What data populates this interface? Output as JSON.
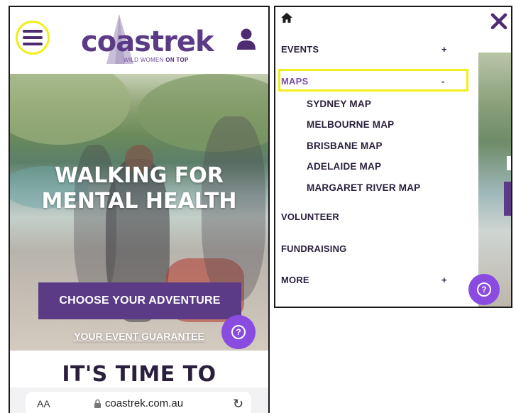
{
  "left_screen": {
    "logo": {
      "word": "coastrek",
      "tagline_prefix": "WILD WOMEN ",
      "tagline_bold": "ON TOP"
    },
    "hero": {
      "title_line1": "WALKING FOR",
      "title_line2": "MENTAL HEALTH",
      "cta_label": "CHOOSE YOUR ADVENTURE",
      "guarantee_link": "YOUR EVENT GUARANTEE"
    },
    "section_heading": "IT'S TIME TO",
    "help_glyph": "?",
    "browser": {
      "aa_label": "AA",
      "url": "coastrek.com.au",
      "reload_glyph": "↻"
    }
  },
  "right_screen": {
    "menu": {
      "events": {
        "label": "EVENTS",
        "toggle": "+"
      },
      "maps": {
        "label": "MAPS",
        "toggle": "-"
      },
      "maps_submenu": [
        "SYDNEY MAP",
        "MELBOURNE MAP",
        "BRISBANE MAP",
        "ADELAIDE MAP",
        "MARGARET RIVER MAP"
      ],
      "volunteer": {
        "label": "VOLUNTEER"
      },
      "fundraising": {
        "label": "FUNDRAISING"
      },
      "more": {
        "label": "MORE",
        "toggle": "+"
      }
    },
    "help_glyph": "?"
  },
  "icons": {
    "hamburger": "hamburger-menu-icon",
    "user": "user-icon",
    "home": "home-icon",
    "close": "close-icon",
    "help": "help-icon",
    "lock": "lock-icon",
    "reload": "reload-icon"
  },
  "colors": {
    "brand_purple": "#5b3b86",
    "help_purple": "#8a4be0",
    "highlight_yellow": "#f2ee1b",
    "maps_purple": "#7a4fb0"
  }
}
